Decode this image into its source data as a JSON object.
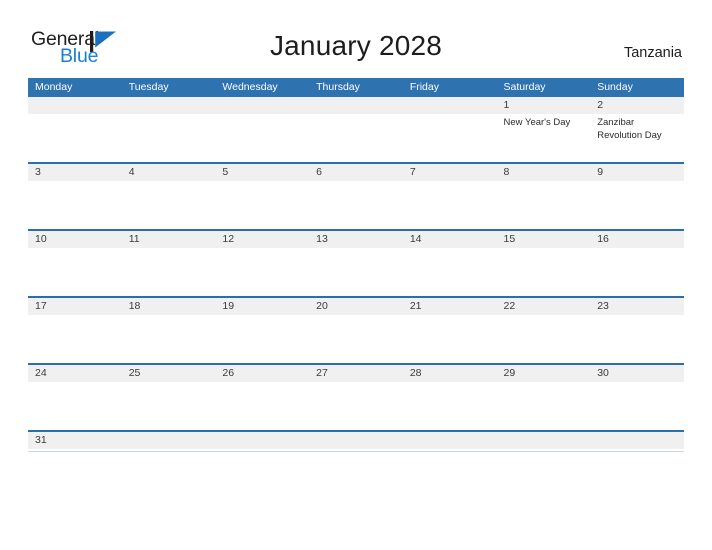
{
  "brand": {
    "word_one": "General",
    "word_two": "Blue",
    "flag_icon": "blue-triangle-flag-icon",
    "color_dark": "#221f1f",
    "color_blue": "#1b7fd4"
  },
  "header": {
    "title": "January 2028",
    "locale": "Tanzania"
  },
  "colors": {
    "header_blue": "#2e72b0",
    "divider_blue": "#2a6ead",
    "band_gray": "#f0f0f0",
    "text_dark": "#3a3a3a",
    "page_background": "#ffffff"
  },
  "calendar": {
    "month": "January",
    "year": "2028",
    "weekday_headers": [
      "Monday",
      "Tuesday",
      "Wednesday",
      "Thursday",
      "Friday",
      "Saturday",
      "Sunday"
    ],
    "weeks": [
      {
        "days": [
          {
            "number": "",
            "events": []
          },
          {
            "number": "",
            "events": []
          },
          {
            "number": "",
            "events": []
          },
          {
            "number": "",
            "events": []
          },
          {
            "number": "",
            "events": []
          },
          {
            "number": "1",
            "events": [
              "New Year's Day"
            ]
          },
          {
            "number": "2",
            "events": [
              "Zanzibar Revolution Day"
            ]
          }
        ]
      },
      {
        "days": [
          {
            "number": "3",
            "events": []
          },
          {
            "number": "4",
            "events": []
          },
          {
            "number": "5",
            "events": []
          },
          {
            "number": "6",
            "events": []
          },
          {
            "number": "7",
            "events": []
          },
          {
            "number": "8",
            "events": []
          },
          {
            "number": "9",
            "events": []
          }
        ]
      },
      {
        "days": [
          {
            "number": "10",
            "events": []
          },
          {
            "number": "11",
            "events": []
          },
          {
            "number": "12",
            "events": []
          },
          {
            "number": "13",
            "events": []
          },
          {
            "number": "14",
            "events": []
          },
          {
            "number": "15",
            "events": []
          },
          {
            "number": "16",
            "events": []
          }
        ]
      },
      {
        "days": [
          {
            "number": "17",
            "events": []
          },
          {
            "number": "18",
            "events": []
          },
          {
            "number": "19",
            "events": []
          },
          {
            "number": "20",
            "events": []
          },
          {
            "number": "21",
            "events": []
          },
          {
            "number": "22",
            "events": []
          },
          {
            "number": "23",
            "events": []
          }
        ]
      },
      {
        "days": [
          {
            "number": "24",
            "events": []
          },
          {
            "number": "25",
            "events": []
          },
          {
            "number": "26",
            "events": []
          },
          {
            "number": "27",
            "events": []
          },
          {
            "number": "28",
            "events": []
          },
          {
            "number": "29",
            "events": []
          },
          {
            "number": "30",
            "events": []
          }
        ]
      },
      {
        "short": true,
        "days": [
          {
            "number": "31",
            "events": []
          },
          {
            "number": "",
            "events": []
          },
          {
            "number": "",
            "events": []
          },
          {
            "number": "",
            "events": []
          },
          {
            "number": "",
            "events": []
          },
          {
            "number": "",
            "events": []
          },
          {
            "number": "",
            "events": []
          }
        ]
      }
    ]
  }
}
